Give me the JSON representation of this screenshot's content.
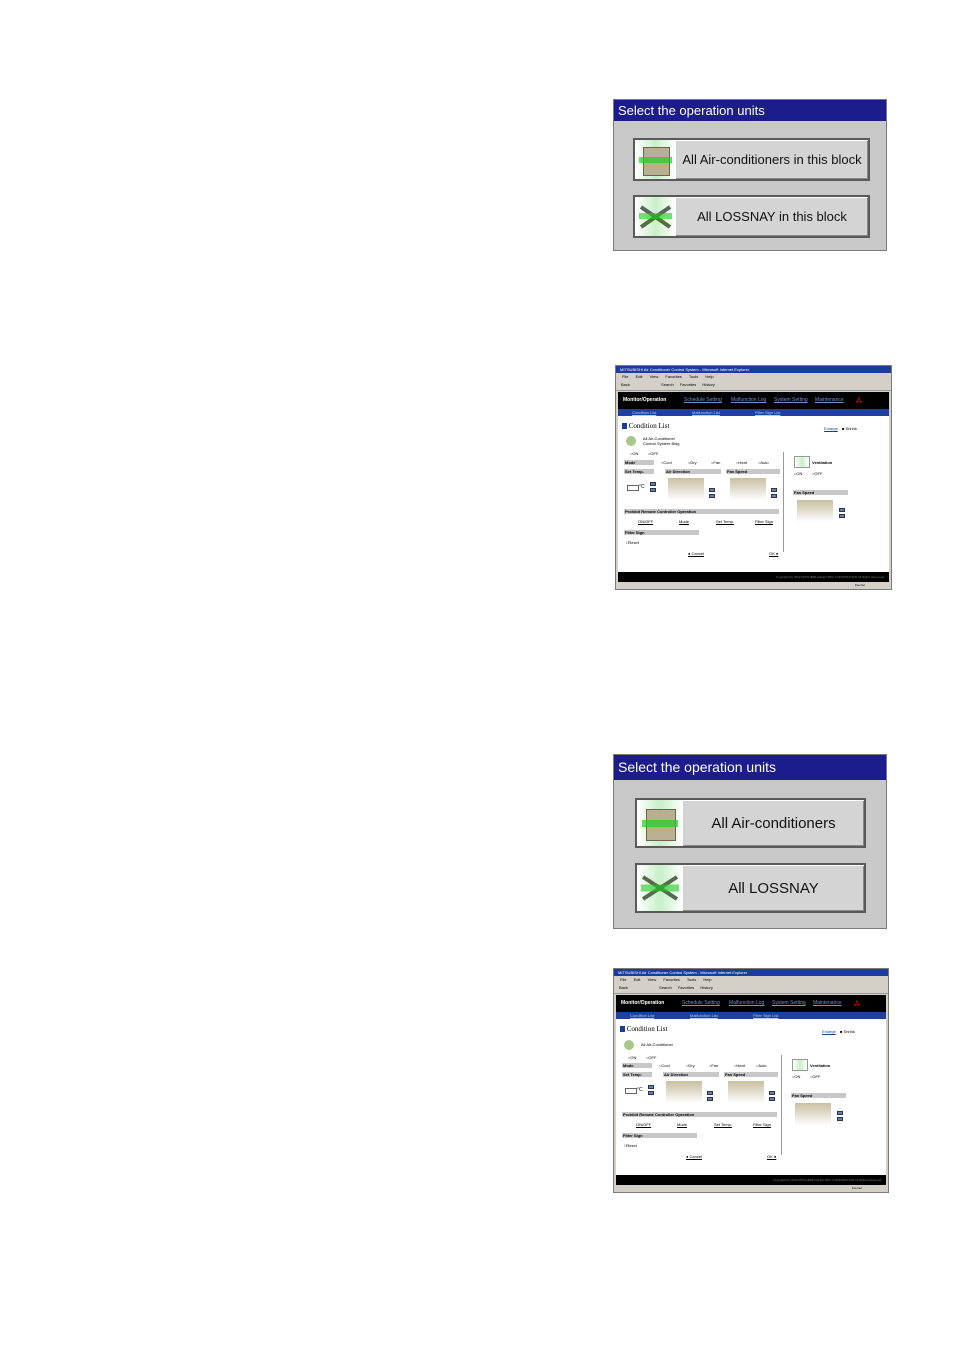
{
  "dialog1": {
    "title": "Select the operation units",
    "btn_ac": "All Air-conditioners in this block",
    "btn_lossnay": "All LOSSNAY in this block"
  },
  "dialog2": {
    "title": "Select the operation units",
    "btn_ac": "All Air-conditioners",
    "btn_lossnay": "All LOSSNAY"
  },
  "browser1": {
    "window_title": "MITSUBISHI Air Conditioner Control System - Microsoft Internet Explorer",
    "menu": [
      "File",
      "Edit",
      "View",
      "Favorites",
      "Tools",
      "Help"
    ],
    "toolbar": [
      "Back",
      "Search",
      "Favorites",
      "History"
    ],
    "nav": [
      "Monitor/Operation",
      "Schedule Setting",
      "Malfunction Log",
      "System Setting",
      "Maintenance"
    ],
    "subnav": [
      "Condition List",
      "Malfunction List",
      "Filter Sign List"
    ],
    "heading": "Condition List",
    "enlarge": "Enlarge",
    "shrink": "Shrink",
    "unit_line1": "All Air-Conditioner",
    "unit_line2": "Control System Bldg",
    "on": "ON",
    "off": "OFF",
    "mode_label": "Mode",
    "modes": [
      "Cool",
      "Dry",
      "Fan",
      "Heat",
      "Auto"
    ],
    "set_temp": "Set Temp.",
    "air_direction": "Air Direction",
    "fan_speed": "Fan Speed",
    "temp_unit": "°C",
    "prohibit": "Prohibit Remote Controller Operation",
    "prohibit_items": [
      "ON/OFF",
      "Mode",
      "Set Temp.",
      "Filter Sign"
    ],
    "filter_sign": "Filter Sign",
    "reset": "Reset",
    "cancel": "Cancel",
    "ok": "OK",
    "ventilation": "Ventilation",
    "vent_fan_speed": "Fan Speed",
    "copyright": "Copyright(C) 2002 MITSUBISHI ELECTRIC CORPORATION All Rights Reserved.",
    "status": "Internet"
  },
  "browser2": {
    "window_title": "MITSUBISHI Air Conditioner Control System - Microsoft Internet Explorer",
    "menu": [
      "File",
      "Edit",
      "View",
      "Favorites",
      "Tools",
      "Help"
    ],
    "toolbar": [
      "Back",
      "Search",
      "Favorites",
      "History"
    ],
    "nav": [
      "Monitor/Operation",
      "Schedule Setting",
      "Malfunction Log",
      "System Setting",
      "Maintenance"
    ],
    "subnav": [
      "Condition List",
      "Malfunction List",
      "Filter Sign List"
    ],
    "heading": "Condition List",
    "enlarge": "Enlarge",
    "shrink": "Shrink",
    "unit_line1": "All Air-Conditioner",
    "on": "ON",
    "off": "OFF",
    "mode_label": "Mode",
    "modes": [
      "Cool",
      "Dry",
      "Fan",
      "Heat",
      "Auto"
    ],
    "set_temp": "Set Temp.",
    "air_direction": "Air Direction",
    "fan_speed": "Fan Speed",
    "temp_unit": "°C",
    "prohibit": "Prohibit Remote Controller Operation",
    "prohibit_items": [
      "ON/OFF",
      "Mode",
      "Set Temp.",
      "Filter Sign"
    ],
    "filter_sign": "Filter Sign",
    "reset": "Reset",
    "cancel": "Cancel",
    "ok": "OK",
    "ventilation": "Ventilation",
    "vent_fan_speed": "Fan Speed",
    "copyright": "Copyright(C) 2002 MITSUBISHI ELECTRIC CORPORATION All Rights Reserved.",
    "status": "Internet"
  }
}
